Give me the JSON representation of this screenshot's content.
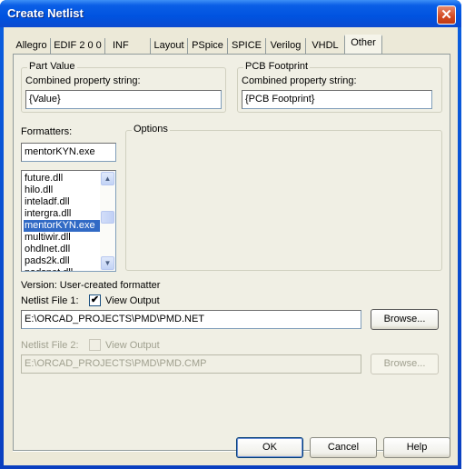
{
  "window": {
    "title": "Create Netlist",
    "close_icon": "close-x-icon"
  },
  "tabs": [
    {
      "label": "Allegro",
      "active": false
    },
    {
      "label": "EDIF 2 0 0",
      "active": false
    },
    {
      "label": "INF",
      "active": false
    },
    {
      "label": "Layout",
      "active": false
    },
    {
      "label": "PSpice",
      "active": false
    },
    {
      "label": "SPICE",
      "active": false
    },
    {
      "label": "Verilog",
      "active": false
    },
    {
      "label": "VHDL",
      "active": false
    },
    {
      "label": "Other",
      "active": true
    }
  ],
  "part_value": {
    "group_label": "Part Value",
    "field_label": "Combined property string:",
    "value": "{Value}"
  },
  "pcb_footprint": {
    "group_label": "PCB Footprint",
    "field_label": "Combined property string:",
    "value": "{PCB Footprint}"
  },
  "formatters": {
    "label": "Formatters:",
    "current_value": "mentorKYN.exe",
    "items": [
      {
        "label": "future.dll",
        "selected": false
      },
      {
        "label": "hilo.dll",
        "selected": false
      },
      {
        "label": "inteladf.dll",
        "selected": false
      },
      {
        "label": "intergra.dll",
        "selected": false
      },
      {
        "label": "mentorKYN.exe",
        "selected": true
      },
      {
        "label": "multiwir.dll",
        "selected": false
      },
      {
        "label": "ohdlnet.dll",
        "selected": false
      },
      {
        "label": "pads2k.dll",
        "selected": false
      },
      {
        "label": "padsnet.dll",
        "selected": false
      }
    ]
  },
  "options": {
    "group_label": "Options"
  },
  "version_text": "Version: User-created formatter",
  "netlist_file_1": {
    "label": "Netlist File 1:",
    "view_output_label": "View Output",
    "view_output_checked": true,
    "path": "E:\\ORCAD_PROJECTS\\PMD\\PMD.NET",
    "browse_label": "Browse...",
    "enabled": true
  },
  "netlist_file_2": {
    "label": "Netlist File 2:",
    "view_output_label": "View Output",
    "view_output_checked": false,
    "path": "E:\\ORCAD_PROJECTS\\PMD\\PMD.CMP",
    "browse_label": "Browse...",
    "enabled": false
  },
  "buttons": {
    "ok": "OK",
    "cancel": "Cancel",
    "help": "Help"
  }
}
